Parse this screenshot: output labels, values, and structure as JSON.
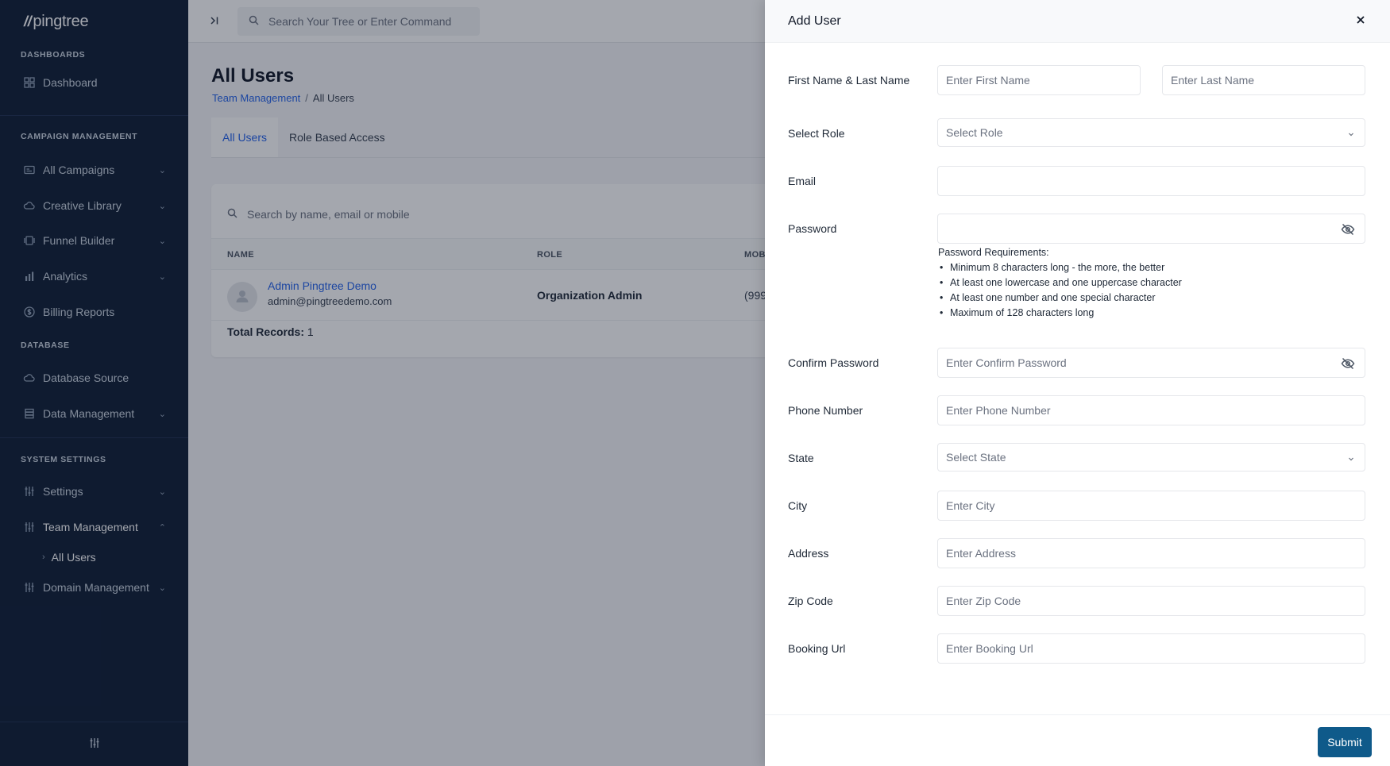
{
  "brand": {
    "slashes": "//",
    "name": "pingtree"
  },
  "sidebar": {
    "sections": {
      "dashboards": "DASHBOARDS",
      "campaign": "CAMPAIGN MANAGEMENT",
      "database": "DATABASE",
      "system": "SYSTEM SETTINGS"
    },
    "items": {
      "dashboard": "Dashboard",
      "all_campaigns": "All Campaigns",
      "creative_library": "Creative Library",
      "funnel_builder": "Funnel Builder",
      "analytics": "Analytics",
      "billing_reports": "Billing Reports",
      "database_source": "Database Source",
      "data_management": "Data Management",
      "settings": "Settings",
      "team_management": "Team Management",
      "all_users": "All Users",
      "domain_management": "Domain Management"
    }
  },
  "topbar": {
    "search_placeholder": "Search Your Tree or Enter Command"
  },
  "page": {
    "title": "All Users",
    "breadcrumb": {
      "parent": "Team Management",
      "separator": "/",
      "current": "All Users"
    },
    "tabs": [
      "All Users",
      "Role Based Access"
    ],
    "table": {
      "search_placeholder": "Search by name, email or mobile",
      "columns": {
        "name": "NAME",
        "role": "ROLE",
        "mobile": "MOB"
      },
      "rows": [
        {
          "name": "Admin Pingtree Demo",
          "email": "admin@pingtreedemo.com",
          "role": "Organization Admin",
          "mobile": "(999"
        }
      ],
      "total_label": "Total Records:",
      "total_value": "1"
    }
  },
  "drawer": {
    "title": "Add User",
    "fields": {
      "name_label": "First Name & Last Name",
      "first_name_placeholder": "Enter First Name",
      "last_name_placeholder": "Enter Last Name",
      "role_label": "Select Role",
      "role_value": "Select Role",
      "email_label": "Email",
      "email_value": "",
      "password_label": "Password",
      "password_value": "",
      "password_requirements_title": "Password Requirements:",
      "password_requirements": [
        "Minimum 8 characters long - the more, the better",
        "At least one lowercase and one uppercase character",
        "At least one number and one special character",
        "Maximum of 128 characters long"
      ],
      "confirm_label": "Confirm Password",
      "confirm_placeholder": "Enter Confirm Password",
      "phone_label": "Phone Number",
      "phone_placeholder": "Enter Phone Number",
      "state_label": "State",
      "state_value": "Select State",
      "city_label": "City",
      "city_placeholder": "Enter City",
      "address_label": "Address",
      "address_placeholder": "Enter Address",
      "zip_label": "Zip Code",
      "zip_placeholder": "Enter Zip Code",
      "booking_label": "Booking Url",
      "booking_placeholder": "Enter Booking Url"
    },
    "submit_label": "Submit"
  },
  "colors": {
    "sidebar_bg": "#0f1e35",
    "accent": "#2563eb",
    "submit_bg": "#0f5a8a"
  },
  "icons": [
    "dashboard-icon",
    "campaigns-icon",
    "cloud-icon",
    "funnel-icon",
    "analytics-icon",
    "billing-icon",
    "database-icon",
    "settings-icon",
    "team-icon",
    "domain-icon",
    "search-icon",
    "collapse-icon",
    "close-icon",
    "eye-off-icon",
    "chevron-down-icon",
    "avatar-icon"
  ]
}
